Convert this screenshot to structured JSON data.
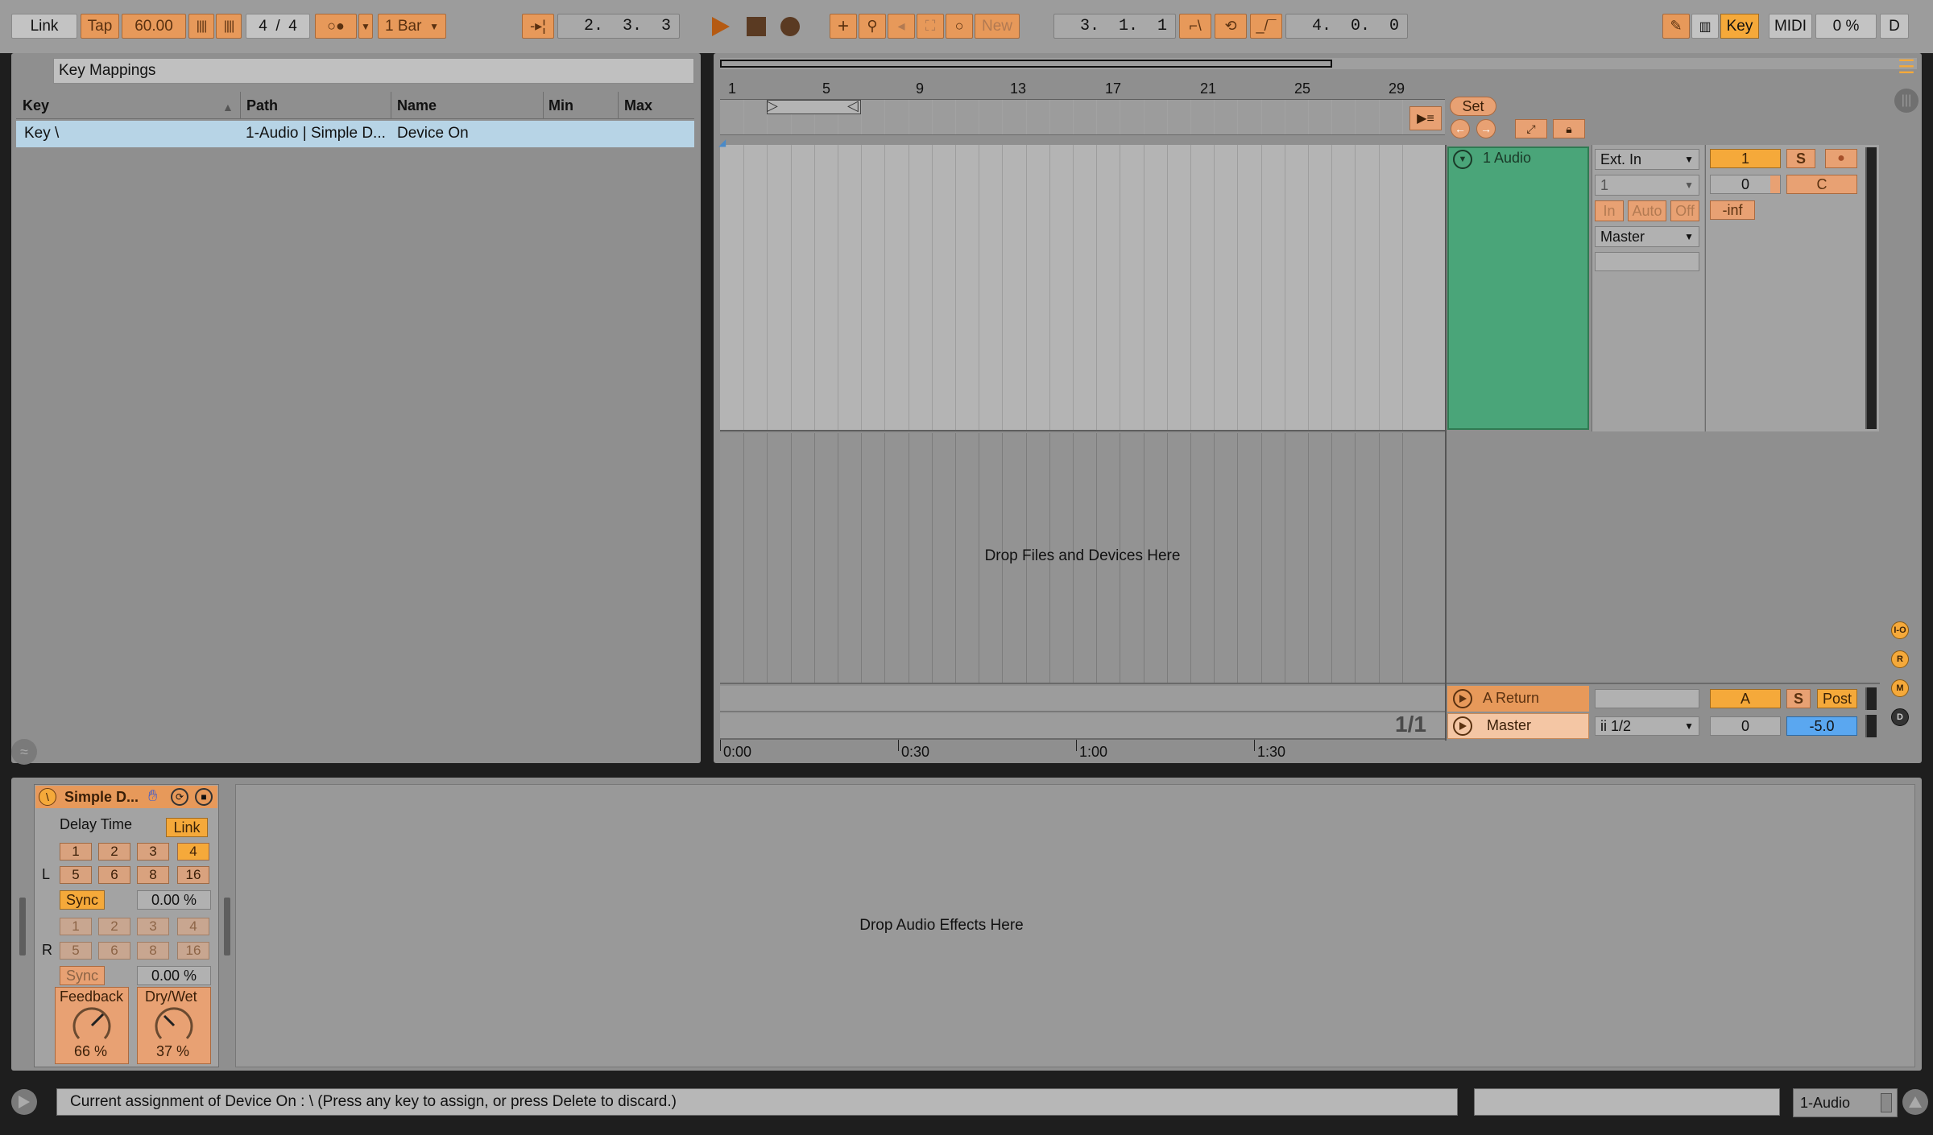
{
  "toolbar": {
    "link": "Link",
    "tap": "Tap",
    "tempo": "60.00",
    "signature": "4  /  4",
    "quantize": "1 Bar",
    "arrangement_position": "2.  3.  3",
    "new": "New",
    "loop_start": "3.  1.  1",
    "loop_length": "4.  0.  0",
    "key": "Key",
    "midi": "MIDI",
    "cpu": "0 %",
    "d": "D"
  },
  "browser": {
    "title": "Key Mappings",
    "columns": [
      "Key",
      "Path",
      "Name",
      "Min",
      "Max"
    ],
    "rows": [
      {
        "key": "Key \\",
        "path": "1-Audio | Simple D...",
        "name": "Device On",
        "min": "",
        "max": ""
      }
    ]
  },
  "arrangement": {
    "bar_numbers": [
      "1",
      "5",
      "9",
      "13",
      "17",
      "21",
      "25",
      "29"
    ],
    "time_markers": [
      "0:00",
      "0:30",
      "1:00",
      "1:30"
    ],
    "drop_hint": "Drop Files and Devices Here",
    "page_indicator": "1/1",
    "set_label": "Set"
  },
  "mixer": {
    "track_name": "1 Audio",
    "input_type": "Ext. In",
    "input_channel": "1",
    "monitor": [
      "In",
      "Auto",
      "Off"
    ],
    "output": "Master",
    "track_number": "1",
    "solo": "S",
    "pan": "0",
    "pan_c": "C",
    "level": "-inf",
    "return_name": "A Return",
    "return_send": "A",
    "return_solo": "S",
    "return_post": "Post",
    "master_name": "Master",
    "master_output": "ii 1/2",
    "master_pan": "0",
    "master_volume": "-5.0"
  },
  "side_icons": [
    "I-O",
    "R",
    "M",
    "D"
  ],
  "device": {
    "title": "Simple D...",
    "delay_time": "Delay Time",
    "link": "Link",
    "left_label": "L",
    "right_label": "R",
    "beats": [
      "1",
      "2",
      "3",
      "4",
      "5",
      "6",
      "8",
      "16"
    ],
    "sync": "Sync",
    "left_offset": "0.00 %",
    "right_offset": "0.00 %",
    "feedback_label": "Feedback",
    "feedback_value": "66 %",
    "drywet_label": "Dry/Wet",
    "drywet_value": "37 %",
    "drop_hint": "Drop Audio Effects Here"
  },
  "status": {
    "message": "Current assignment of Device On : \\  (Press any key to assign, or press Delete to discard.)",
    "track": "1-Audio"
  },
  "colors": {
    "accent_orange": "#f5a93a",
    "track_green": "#4aa579",
    "master_blue": "#5aa7f0"
  }
}
